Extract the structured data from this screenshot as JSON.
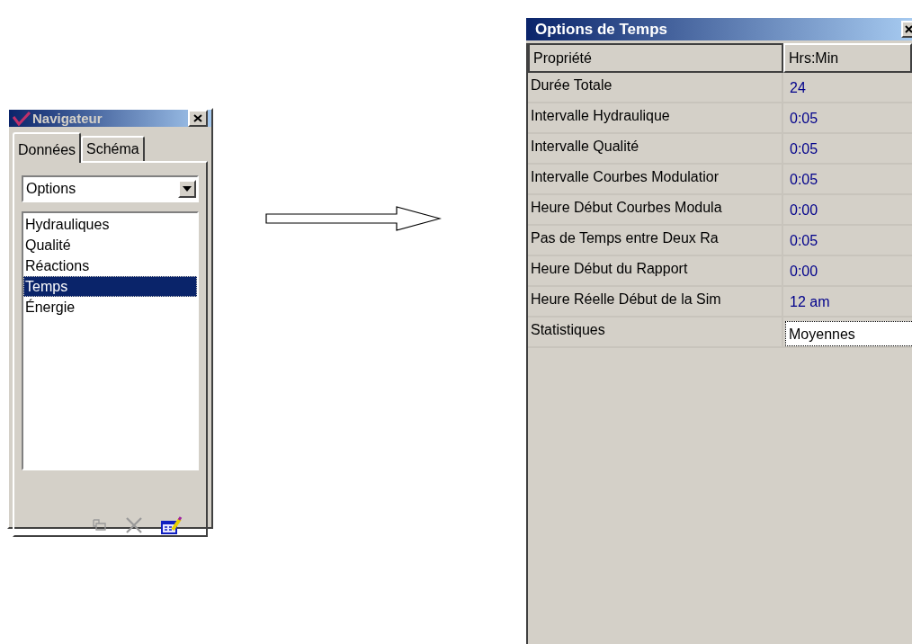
{
  "navigator": {
    "title": "Navigateur",
    "tabs": [
      {
        "label": "Données",
        "selected": true
      },
      {
        "label": "Schéma",
        "selected": false
      }
    ],
    "dropdown": {
      "value": "Options"
    },
    "items": [
      {
        "label": "Hydrauliques",
        "selected": false
      },
      {
        "label": "Qualité",
        "selected": false
      },
      {
        "label": "Réactions",
        "selected": false
      },
      {
        "label": "Temps",
        "selected": true
      },
      {
        "label": "Énergie",
        "selected": false
      }
    ]
  },
  "options_window": {
    "title": "Options de Temps",
    "columns": [
      "Propriété",
      "Hrs:Min"
    ],
    "rows": [
      {
        "property": "Durée Totale",
        "value": "24",
        "kind": "text"
      },
      {
        "property": "Intervalle Hydraulique",
        "value": "0:05",
        "kind": "text"
      },
      {
        "property": "Intervalle Qualité",
        "value": "0:05",
        "kind": "text"
      },
      {
        "property": "Intervalle Courbes Modulatior",
        "value": "0:05",
        "kind": "text"
      },
      {
        "property": "Heure Début Courbes Modula",
        "value": "0:00",
        "kind": "text"
      },
      {
        "property": "Pas de Temps entre Deux Ra",
        "value": "0:05",
        "kind": "text"
      },
      {
        "property": "Heure Début du Rapport",
        "value": "0:00",
        "kind": "text"
      },
      {
        "property": "Heure Réelle Début de la Sim",
        "value": "12 am",
        "kind": "text"
      },
      {
        "property": "Statistiques",
        "value": "Moyennes",
        "kind": "choice"
      }
    ]
  }
}
